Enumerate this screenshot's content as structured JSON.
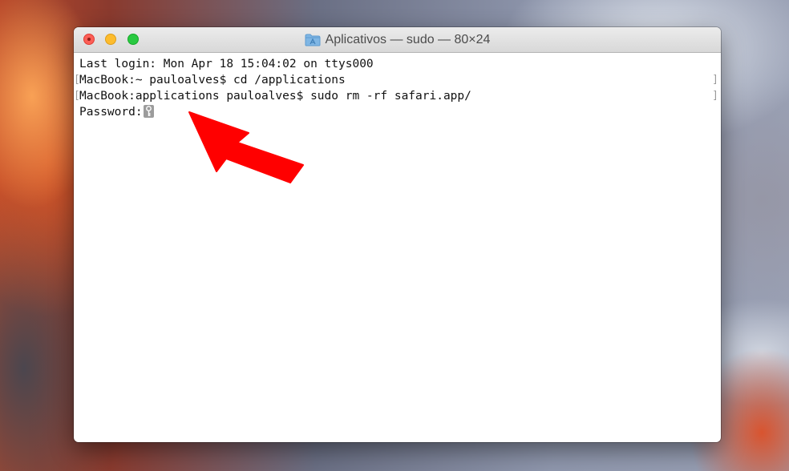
{
  "window": {
    "title": "Aplicativos — sudo — 80×24"
  },
  "terminal": {
    "lines": [
      "Last login: Mon Apr 18 15:04:02 on ttys000",
      "MacBook:~ pauloalves$ cd /applications",
      "MacBook:applications pauloalves$ sudo rm -rf safari.app/",
      "Password:"
    ]
  },
  "icons": {
    "close": "close-button",
    "minimize": "minimize-button",
    "zoom": "zoom-button",
    "folder": "folder-icon",
    "cursor": "key-cursor-icon",
    "annotation": "red-arrow-icon"
  },
  "colors": {
    "annotation_arrow": "#ff0000",
    "close": "#fc5f57",
    "minimize": "#fdbc2e",
    "zoom": "#29c941"
  }
}
